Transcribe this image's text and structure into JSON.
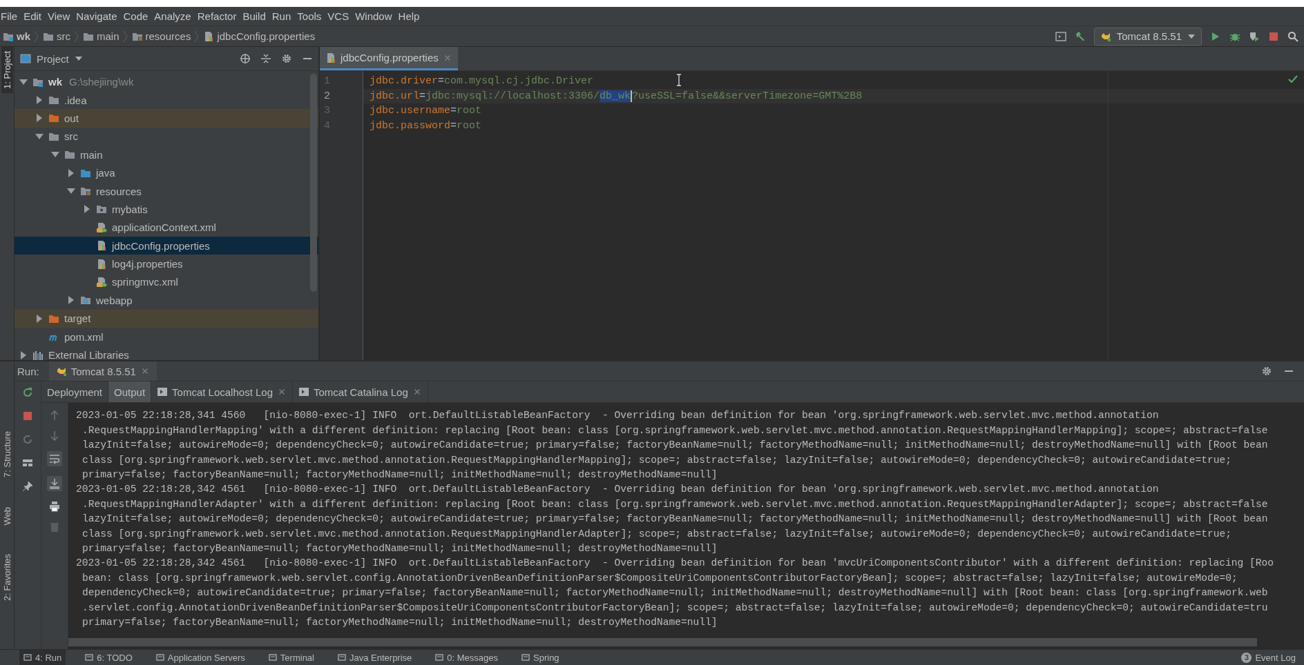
{
  "menu": [
    "File",
    "Edit",
    "View",
    "Navigate",
    "Code",
    "Analyze",
    "Refactor",
    "Build",
    "Run",
    "Tools",
    "VCS",
    "Window",
    "Help"
  ],
  "breadcrumb": [
    {
      "label": "wk",
      "kind": "project"
    },
    {
      "label": "src",
      "kind": "folder"
    },
    {
      "label": "main",
      "kind": "folder"
    },
    {
      "label": "resources",
      "kind": "resources"
    },
    {
      "label": "jdbcConfig.properties",
      "kind": "properties"
    }
  ],
  "toolbar": {
    "run_config": "Tomcat 8.5.51"
  },
  "side_tools": [
    {
      "label": "1: Project",
      "selected": true
    },
    {
      "label": "7: Structure",
      "selected": false
    },
    {
      "label": "Web",
      "selected": false
    },
    {
      "label": "2: Favorites",
      "selected": false
    }
  ],
  "project_panel": {
    "title": "Project",
    "tree": [
      {
        "label": "wk",
        "hint": "G:\\shejiing\\wk",
        "kind": "project",
        "expanded": true,
        "selected": false,
        "excluded": false,
        "children": [
          {
            "label": ".idea",
            "kind": "folder",
            "expanded": false,
            "selected": false,
            "excluded": false
          },
          {
            "label": "out",
            "kind": "folder",
            "expanded": false,
            "selected": false,
            "excluded": true
          },
          {
            "label": "src",
            "kind": "folder",
            "expanded": true,
            "selected": false,
            "excluded": false,
            "children": [
              {
                "label": "main",
                "kind": "folder",
                "expanded": true,
                "selected": false,
                "excluded": false,
                "children": [
                  {
                    "label": "java",
                    "kind": "source",
                    "expanded": false,
                    "selected": false,
                    "excluded": false
                  },
                  {
                    "label": "resources",
                    "kind": "resources",
                    "expanded": true,
                    "selected": false,
                    "excluded": false,
                    "children": [
                      {
                        "label": "mybatis",
                        "kind": "package",
                        "expanded": false,
                        "selected": false,
                        "excluded": false
                      },
                      {
                        "label": "applicationContext.xml",
                        "kind": "xml",
                        "selected": false,
                        "excluded": false
                      },
                      {
                        "label": "jdbcConfig.properties",
                        "kind": "properties",
                        "selected": true,
                        "excluded": false
                      },
                      {
                        "label": "log4j.properties",
                        "kind": "properties",
                        "selected": false,
                        "excluded": false
                      },
                      {
                        "label": "springmvc.xml",
                        "kind": "xml",
                        "selected": false,
                        "excluded": false
                      }
                    ]
                  },
                  {
                    "label": "webapp",
                    "kind": "web",
                    "expanded": false,
                    "selected": false,
                    "excluded": false
                  }
                ]
              }
            ]
          },
          {
            "label": "target",
            "kind": "folder",
            "expanded": false,
            "selected": false,
            "excluded": true
          },
          {
            "label": "pom.xml",
            "kind": "maven",
            "selected": false,
            "excluded": false
          }
        ]
      },
      {
        "label": "External Libraries",
        "kind": "libraries",
        "expanded": false,
        "selected": false,
        "excluded": false
      }
    ]
  },
  "editor": {
    "tab": "jdbcConfig.properties",
    "lines": [
      {
        "number": "1",
        "current": false,
        "segments": [
          {
            "text": "jdbc.driver",
            "kind": "key"
          },
          {
            "text": "=",
            "kind": "separator"
          },
          {
            "text": "com.mysql.cj.jdbc.Driver",
            "kind": "value"
          }
        ]
      },
      {
        "number": "2",
        "current": true,
        "segments": [
          {
            "text": "jdbc.url",
            "kind": "key"
          },
          {
            "text": "=",
            "kind": "separator"
          },
          {
            "text": "jdbc:mysql://localhost:3306/",
            "kind": "value"
          },
          {
            "text": "db_wk",
            "kind": "selection"
          },
          {
            "text": "?useSSL=false&&serverTimezone=GMT%2B8",
            "kind": "value"
          }
        ]
      },
      {
        "number": "3",
        "current": false,
        "segments": [
          {
            "text": "jdbc.username",
            "kind": "key"
          },
          {
            "text": "=",
            "kind": "separator"
          },
          {
            "text": "root",
            "kind": "value"
          }
        ]
      },
      {
        "number": "4",
        "current": false,
        "segments": [
          {
            "text": "jdbc.password",
            "kind": "key"
          },
          {
            "text": "=",
            "kind": "separator"
          },
          {
            "text": "root",
            "kind": "value"
          }
        ]
      }
    ]
  },
  "run_panel": {
    "label": "Run:",
    "tab": "Tomcat 8.5.51",
    "subtabs": [
      {
        "label": "Deployment",
        "kind": "plain",
        "selected": false
      },
      {
        "label": "Output",
        "kind": "plain",
        "selected": true
      },
      {
        "label": "Tomcat Localhost Log",
        "kind": "log",
        "selected": false
      },
      {
        "label": "Tomcat Catalina Log",
        "kind": "log",
        "selected": false
      }
    ],
    "console": [
      {
        "kind": "entry",
        "text": "2023-01-05 22:18:28,341 4560   [nio-8080-exec-1] INFO  ort.DefaultListableBeanFactory  - Overriding bean definition for bean 'org.springframework.web.servlet.mvc.method.annotation"
      },
      {
        "kind": "continuation",
        "text": ".RequestMappingHandlerMapping' with a different definition: replacing [Root bean: class [org.springframework.web.servlet.mvc.method.annotation.RequestMappingHandlerMapping]; scope=; abstract=false"
      },
      {
        "kind": "continuation",
        "text": "lazyInit=false; autowireMode=0; dependencyCheck=0; autowireCandidate=true; primary=false; factoryBeanName=null; factoryMethodName=null; initMethodName=null; destroyMethodName=null] with [Root bean"
      },
      {
        "kind": "continuation",
        "text": "class [org.springframework.web.servlet.mvc.method.annotation.RequestMappingHandlerMapping]; scope=; abstract=false; lazyInit=false; autowireMode=0; dependencyCheck=0; autowireCandidate=true;"
      },
      {
        "kind": "continuation",
        "text": "primary=false; factoryBeanName=null; factoryMethodName=null; initMethodName=null; destroyMethodName=null]"
      },
      {
        "kind": "entry",
        "text": "2023-01-05 22:18:28,342 4561   [nio-8080-exec-1] INFO  ort.DefaultListableBeanFactory  - Overriding bean definition for bean 'org.springframework.web.servlet.mvc.method.annotation"
      },
      {
        "kind": "continuation",
        "text": ".RequestMappingHandlerAdapter' with a different definition: replacing [Root bean: class [org.springframework.web.servlet.mvc.method.annotation.RequestMappingHandlerAdapter]; scope=; abstract=false"
      },
      {
        "kind": "continuation",
        "text": "lazyInit=false; autowireMode=0; dependencyCheck=0; autowireCandidate=true; primary=false; factoryBeanName=null; factoryMethodName=null; initMethodName=null; destroyMethodName=null] with [Root bean"
      },
      {
        "kind": "continuation",
        "text": "class [org.springframework.web.servlet.mvc.method.annotation.RequestMappingHandlerAdapter]; scope=; abstract=false; lazyInit=false; autowireMode=0; dependencyCheck=0; autowireCandidate=true;"
      },
      {
        "kind": "continuation",
        "text": "primary=false; factoryBeanName=null; factoryMethodName=null; initMethodName=null; destroyMethodName=null]"
      },
      {
        "kind": "entry",
        "text": "2023-01-05 22:18:28,342 4561   [nio-8080-exec-1] INFO  ort.DefaultListableBeanFactory  - Overriding bean definition for bean 'mvcUriComponentsContributor' with a different definition: replacing [Roo"
      },
      {
        "kind": "continuation",
        "text": "bean: class [org.springframework.web.servlet.config.AnnotationDrivenBeanDefinitionParser$CompositeUriComponentsContributorFactoryBean]; scope=; abstract=false; lazyInit=false; autowireMode=0;"
      },
      {
        "kind": "continuation",
        "text": "dependencyCheck=0; autowireCandidate=true; primary=false; factoryBeanName=null; factoryMethodName=null; initMethodName=null; destroyMethodName=null] with [Root bean: class [org.springframework.web"
      },
      {
        "kind": "continuation",
        "text": ".servlet.config.AnnotationDrivenBeanDefinitionParser$CompositeUriComponentsContributorFactoryBean]; scope=; abstract=false; lazyInit=false; autowireMode=0; dependencyCheck=0; autowireCandidate=tru"
      },
      {
        "kind": "continuation",
        "text": "primary=false; factoryBeanName=null; factoryMethodName=null; initMethodName=null; destroyMethodName=null]"
      }
    ]
  },
  "tool_windows": [
    {
      "label": "4: Run",
      "selected": true
    },
    {
      "label": "6: TODO",
      "selected": false
    },
    {
      "label": "Application Servers",
      "selected": false
    },
    {
      "label": "Terminal",
      "selected": false
    },
    {
      "label": "Java Enterprise",
      "selected": false
    },
    {
      "label": "0: Messages",
      "selected": false
    },
    {
      "label": "Spring",
      "selected": false
    }
  ],
  "event_log": {
    "count": "3",
    "label": "Event Log"
  }
}
